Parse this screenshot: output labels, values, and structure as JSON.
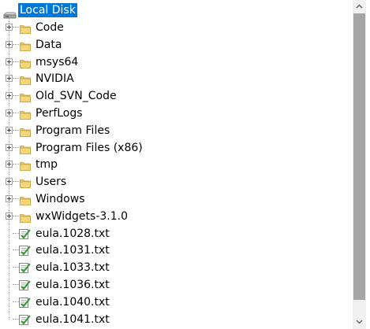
{
  "tree": {
    "root": {
      "label": "Local Disk",
      "icon": "drive-icon",
      "selected": true
    },
    "folders": [
      {
        "label": "Code",
        "icon": "folder-icon"
      },
      {
        "label": "Data",
        "icon": "folder-icon"
      },
      {
        "label": "msys64",
        "icon": "folder-icon"
      },
      {
        "label": "NVIDIA",
        "icon": "folder-icon"
      },
      {
        "label": "Old_SVN_Code",
        "icon": "folder-icon"
      },
      {
        "label": "PerfLogs",
        "icon": "folder-icon"
      },
      {
        "label": "Program Files",
        "icon": "folder-icon"
      },
      {
        "label": "Program Files (x86)",
        "icon": "folder-icon"
      },
      {
        "label": "tmp",
        "icon": "folder-icon"
      },
      {
        "label": "Users",
        "icon": "folder-icon"
      },
      {
        "label": "Windows",
        "icon": "folder-icon"
      },
      {
        "label": "wxWidgets-3.1.0",
        "icon": "folder-icon"
      }
    ],
    "files": [
      {
        "label": "eula.1028.txt",
        "icon": "text-file-icon"
      },
      {
        "label": "eula.1031.txt",
        "icon": "text-file-icon"
      },
      {
        "label": "eula.1033.txt",
        "icon": "text-file-icon"
      },
      {
        "label": "eula.1036.txt",
        "icon": "text-file-icon"
      },
      {
        "label": "eula.1040.txt",
        "icon": "text-file-icon"
      },
      {
        "label": "eula.1041.txt",
        "icon": "text-file-icon"
      }
    ]
  },
  "colors": {
    "selection": "#0078d7",
    "selection_text": "#ffffff",
    "folder": "#e8c35a",
    "tree_lines": "#a0a0a0",
    "scroll_track": "#f0f0f0",
    "scroll_thumb": "#a6a6a6"
  },
  "scrollbar": {
    "up_icon": "arrow-up-icon",
    "down_icon": "arrow-down-icon"
  }
}
